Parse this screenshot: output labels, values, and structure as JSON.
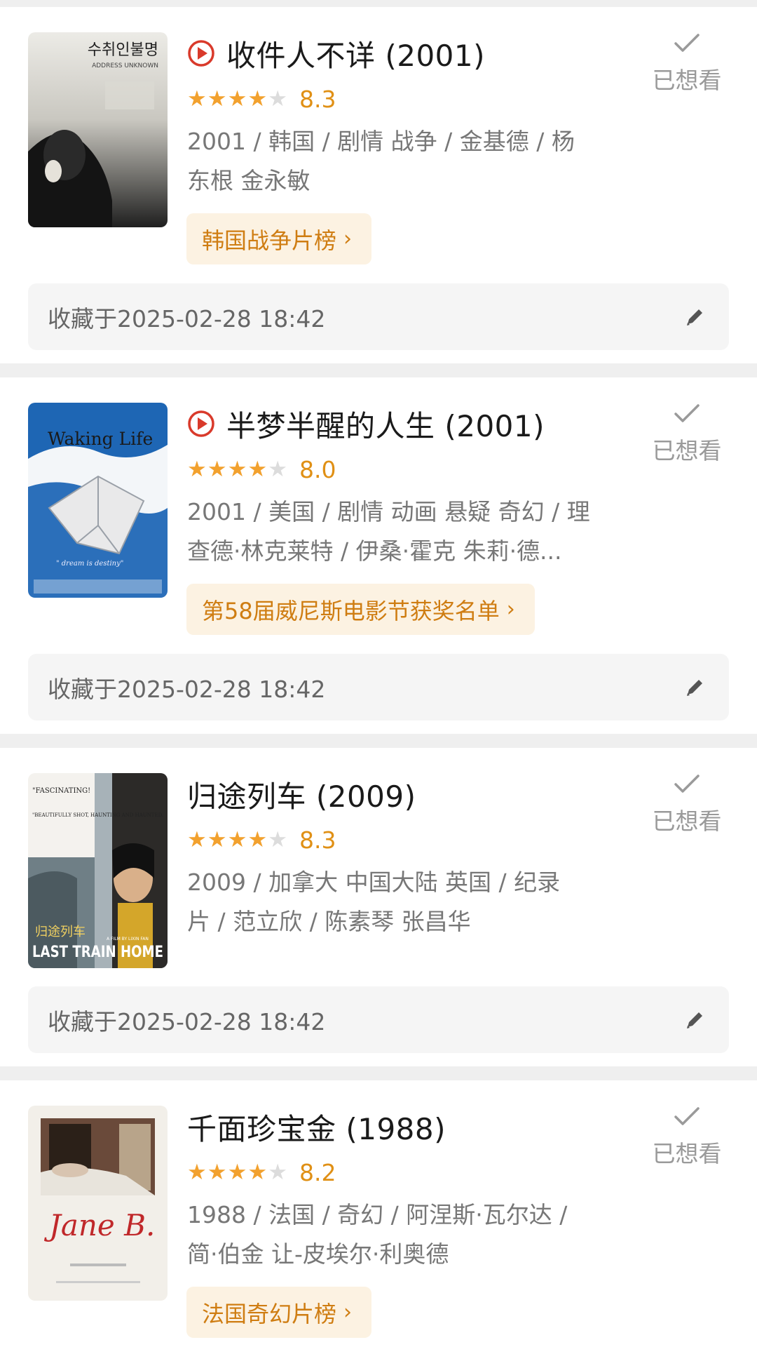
{
  "colors": {
    "star_filled": "#f2a12e",
    "star_empty": "#dcdcdc",
    "score": "#e09015",
    "chip_bg": "#fcf2e2",
    "chip_text": "#cf7d12",
    "play_icon": "#d93a2b"
  },
  "movies": [
    {
      "title": "收件人不详 (2001)",
      "has_play_icon": true,
      "stars": 4,
      "score": "8.3",
      "meta_line1": "2001 / 韩国 / 剧情 战争 / 金基德 / 杨",
      "meta_line2": "东根 金永敏",
      "chip_label": "韩国战争片榜",
      "want_label": "已想看",
      "saved_at": "收藏于2025-02-28 18:42",
      "poster": {
        "title_text": "수취인불명",
        "subtitle_text": "ADDRESS UNKNOWN"
      }
    },
    {
      "title": "半梦半醒的人生 (2001)",
      "has_play_icon": true,
      "stars": 4,
      "score": "8.0",
      "meta_line1": "2001 / 美国 / 剧情 动画 悬疑 奇幻 / 理",
      "meta_line2": "查德·林克莱特 / 伊桑·霍克 朱莉·德...",
      "chip_label": "第58届威尼斯电影节获奖名单",
      "want_label": "已想看",
      "saved_at": "收藏于2025-02-28 18:42",
      "poster": {
        "title_text": "Waking Life",
        "tagline": "\" dream is destiny\""
      }
    },
    {
      "title": "归途列车 (2009)",
      "has_play_icon": false,
      "stars": 4,
      "score": "8.3",
      "meta_line1": "2009 / 加拿大 中国大陆 英国 / 纪录",
      "meta_line2": "片 / 范立欣 / 陈素琴 张昌华",
      "chip_label": "",
      "want_label": "已想看",
      "saved_at": "收藏于2025-02-28 18:42",
      "poster": {
        "quote1": "\"FASCINATING!",
        "quote2": "\"BEAUTIFULLY SHOT, HAUNTING AND HAUNTED.",
        "cn_title": "归途列车",
        "en_title": "LAST TRAIN HOME",
        "credit": "A FILM BY LIXIN FAN"
      }
    },
    {
      "title": "千面珍宝金 (1988)",
      "has_play_icon": false,
      "stars": 4,
      "score": "8.2",
      "meta_line1": "1988 / 法国 / 奇幻 / 阿涅斯·瓦尔达 /",
      "meta_line2": "简·伯金 让-皮埃尔·利奥德",
      "chip_label": "法国奇幻片榜",
      "want_label": "已想看",
      "saved_at": "",
      "poster": {
        "title_text": "Jane B."
      }
    }
  ]
}
